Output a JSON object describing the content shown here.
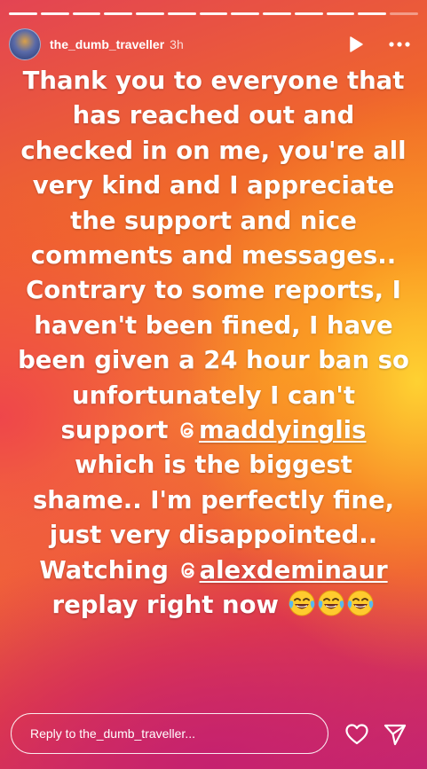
{
  "header": {
    "username": "the_dumb_traveller",
    "time_ago": "3h",
    "play_icon": "play-icon",
    "more_icon": "more-horizontal-icon"
  },
  "progress": {
    "segments": 13,
    "completed": 12
  },
  "story": {
    "text_part1": "Thank you to everyone that has reached out and checked in on me, you're all very kind and I appreciate the support and nice comments and messages.. Contrary to some reports, I haven't been fined, I have been given a 24 hour ban so unfortunately I can't support ",
    "mention1": "maddyinglis",
    "text_part2": " which is the biggest shame.. I'm perfectly fine, just very disappointed.. Watching ",
    "mention2": "alexdeminaur",
    "text_part3": " replay right now ",
    "mention_icon": "threads-icon",
    "emoji_icon": "face-with-tears-of-joy-icon",
    "emoji_count": 3
  },
  "footer": {
    "reply_placeholder": "Reply to the_dumb_traveller...",
    "like_icon": "heart-icon",
    "share_icon": "send-icon"
  },
  "colors": {
    "gradient_top": "#e34453",
    "gradient_mid": "#f6882a",
    "gradient_highlight": "#ffd632",
    "gradient_bottom": "#c52771",
    "text": "#ffffff"
  }
}
